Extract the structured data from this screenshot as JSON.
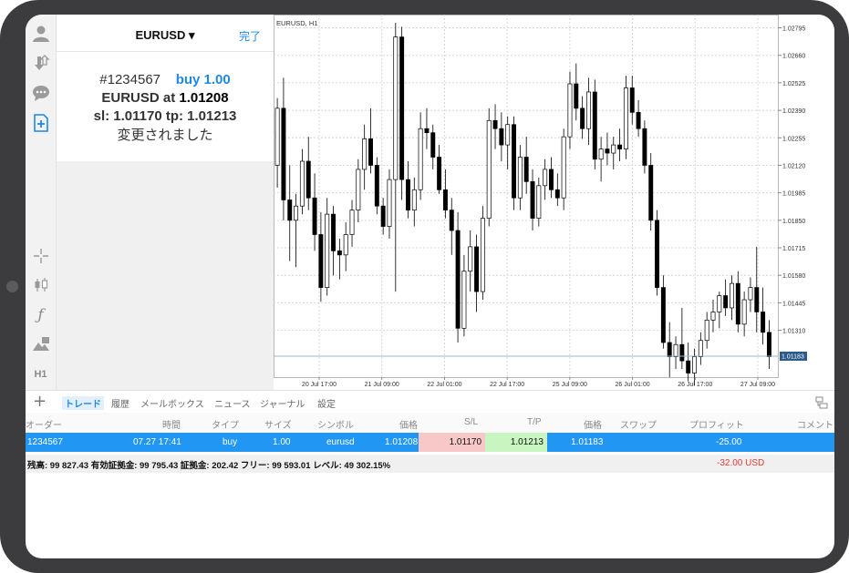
{
  "order_panel": {
    "symbol_selector": "EURUSD ▾",
    "done_label": "完了",
    "order_number": "#1234567",
    "order_action": "buy 1.00",
    "price_prefix": "EURUSD at",
    "price_value": "1.01208",
    "sl_tp_line": "sl: 1.01170 tp: 1.01213",
    "status_message": "変更されました"
  },
  "toolbar": {
    "timeframe_label": "H1"
  },
  "chart": {
    "title": "EURUSD, H1",
    "current_price": "1.01183",
    "colors": {
      "bull": "#ffffff",
      "bear": "#000000",
      "grid": "#d0d0d0",
      "price_line": "#9eb4cc",
      "price_tag": "#2a5a8a"
    }
  },
  "chart_data": {
    "type": "candlestick",
    "title": "EURUSD, H1",
    "ylim": [
      1.0108,
      1.0286
    ],
    "y_ticks": [
      "1.02795",
      "1.02660",
      "1.02525",
      "1.02390",
      "1.02255",
      "1.02120",
      "1.01985",
      "1.01850",
      "1.01715",
      "1.01580",
      "1.01445",
      "1.01310"
    ],
    "x_ticks": [
      "20 Jul 17:00",
      "21 Jul 09:00",
      "22 Jul 01:00",
      "22 Jul 17:00",
      "25 Jul 09:00",
      "26 Jul 01:00",
      "26 Jul 17:00",
      "27 Jul 09:00"
    ],
    "candles": [
      [
        1.0212,
        1.0245,
        1.0201,
        1.024
      ],
      [
        1.024,
        1.0255,
        1.0185,
        1.0195
      ],
      [
        1.0195,
        1.0212,
        1.0165,
        1.0185
      ],
      [
        1.0185,
        1.0198,
        1.0162,
        1.0192
      ],
      [
        1.0192,
        1.022,
        1.0188,
        1.0214
      ],
      [
        1.0214,
        1.0226,
        1.019,
        1.0196
      ],
      [
        1.0196,
        1.0208,
        1.017,
        1.0178
      ],
      [
        1.0178,
        1.0189,
        1.0145,
        1.0152
      ],
      [
        1.0152,
        1.0196,
        1.0148,
        1.0188
      ],
      [
        1.0188,
        1.0192,
        1.0158,
        1.017
      ],
      [
        1.017,
        1.0176,
        1.0156,
        1.0168
      ],
      [
        1.0168,
        1.0184,
        1.016,
        1.0178
      ],
      [
        1.0178,
        1.0195,
        1.0172,
        1.019
      ],
      [
        1.019,
        1.0215,
        1.0184,
        1.021
      ],
      [
        1.021,
        1.0232,
        1.02,
        1.0225
      ],
      [
        1.0225,
        1.024,
        1.0208,
        1.0212
      ],
      [
        1.0212,
        1.0216,
        1.0188,
        1.0192
      ],
      [
        1.0192,
        1.0196,
        1.0178,
        1.0182
      ],
      [
        1.0182,
        1.021,
        1.0176,
        1.0205
      ],
      [
        1.0205,
        1.0282,
        1.015,
        1.0275
      ],
      [
        1.0275,
        1.028,
        1.0195,
        1.0205
      ],
      [
        1.0205,
        1.0214,
        1.0186,
        1.019
      ],
      [
        1.019,
        1.0206,
        1.0182,
        1.02
      ],
      [
        1.02,
        1.0238,
        1.0195,
        1.023
      ],
      [
        1.023,
        1.024,
        1.022,
        1.0228
      ],
      [
        1.0228,
        1.0232,
        1.021,
        1.0216
      ],
      [
        1.0216,
        1.0222,
        1.0198,
        1.02
      ],
      [
        1.02,
        1.021,
        1.0186,
        1.019
      ],
      [
        1.019,
        1.0196,
        1.0168,
        1.018
      ],
      [
        1.018,
        1.0189,
        1.0125,
        1.0132
      ],
      [
        1.0132,
        1.0168,
        1.0128,
        1.016
      ],
      [
        1.016,
        1.018,
        1.015,
        1.0172
      ],
      [
        1.0172,
        1.0178,
        1.014,
        1.015
      ],
      [
        1.015,
        1.0192,
        1.0146,
        1.0186
      ],
      [
        1.0186,
        1.024,
        1.0182,
        1.0234
      ],
      [
        1.0234,
        1.0242,
        1.022,
        1.023
      ],
      [
        1.023,
        1.0238,
        1.0214,
        1.0222
      ],
      [
        1.0222,
        1.0236,
        1.021,
        1.0232
      ],
      [
        1.0232,
        1.0236,
        1.019,
        1.0196
      ],
      [
        1.0196,
        1.0222,
        1.019,
        1.0216
      ],
      [
        1.0216,
        1.0226,
        1.0198,
        1.0204
      ],
      [
        1.0204,
        1.021,
        1.018,
        1.0186
      ],
      [
        1.0186,
        1.0206,
        1.0182,
        1.0202
      ],
      [
        1.0202,
        1.0215,
        1.0195,
        1.021
      ],
      [
        1.021,
        1.0216,
        1.0196,
        1.02
      ],
      [
        1.02,
        1.0208,
        1.0192,
        1.0196
      ],
      [
        1.0196,
        1.023,
        1.019,
        1.0226
      ],
      [
        1.0226,
        1.0258,
        1.022,
        1.0252
      ],
      [
        1.0252,
        1.0262,
        1.0234,
        1.024
      ],
      [
        1.024,
        1.0246,
        1.0225,
        1.023
      ],
      [
        1.023,
        1.0255,
        1.0222,
        1.0248
      ],
      [
        1.0248,
        1.0254,
        1.021,
        1.0215
      ],
      [
        1.0215,
        1.0226,
        1.0204,
        1.022
      ],
      [
        1.022,
        1.0228,
        1.0212,
        1.0218
      ],
      [
        1.0218,
        1.0226,
        1.021,
        1.0222
      ],
      [
        1.0222,
        1.023,
        1.0214,
        1.022
      ],
      [
        1.022,
        1.0256,
        1.0215,
        1.025
      ],
      [
        1.025,
        1.0256,
        1.0232,
        1.0238
      ],
      [
        1.0238,
        1.0244,
        1.0226,
        1.023
      ],
      [
        1.023,
        1.0234,
        1.0208,
        1.0212
      ],
      [
        1.0212,
        1.0218,
        1.018,
        1.0185
      ],
      [
        1.0185,
        1.019,
        1.0148,
        1.0152
      ],
      [
        1.0152,
        1.0158,
        1.0122,
        1.0125
      ],
      [
        1.0125,
        1.0135,
        1.0108,
        1.0118
      ],
      [
        1.0118,
        1.0128,
        1.0112,
        1.0124
      ],
      [
        1.0124,
        1.0142,
        1.0112,
        1.0116
      ],
      [
        1.0116,
        1.0125,
        1.0106,
        1.011
      ],
      [
        1.011,
        1.0122,
        1.0104,
        1.0118
      ],
      [
        1.0118,
        1.013,
        1.0114,
        1.0126
      ],
      [
        1.0126,
        1.014,
        1.0122,
        1.0136
      ],
      [
        1.0136,
        1.0146,
        1.013,
        1.014
      ],
      [
        1.014,
        1.015,
        1.0132,
        1.0148
      ],
      [
        1.0148,
        1.0156,
        1.0138,
        1.0142
      ],
      [
        1.0142,
        1.0158,
        1.0136,
        1.0154
      ],
      [
        1.0154,
        1.016,
        1.013,
        1.0134
      ],
      [
        1.0134,
        1.015,
        1.0128,
        1.0146
      ],
      [
        1.0146,
        1.0157,
        1.014,
        1.0152
      ],
      [
        1.0152,
        1.0172,
        1.013,
        1.014
      ],
      [
        1.014,
        1.0152,
        1.0124,
        1.013
      ],
      [
        1.013,
        1.0136,
        1.0112,
        1.0118
      ]
    ]
  },
  "tabs": [
    {
      "label": "トレード",
      "active": true
    },
    {
      "label": "履歴"
    },
    {
      "label": "メールボックス"
    },
    {
      "label": "ニュース"
    },
    {
      "label": "ジャーナル"
    },
    {
      "label": "設定"
    }
  ],
  "table": {
    "headers": [
      "オーダー",
      "時間",
      "タイプ",
      "サイズ",
      "シンボル",
      "価格",
      "S/L",
      "T/P",
      "価格",
      "スワップ",
      "プロフィット",
      "コメント"
    ],
    "row": {
      "order": "1234567",
      "time": "07.27 17:41",
      "type": "buy",
      "size": "1.00",
      "symbol": "eurusd",
      "price": "1.01208",
      "sl": "1.01170",
      "tp": "1.01213",
      "current_price": "1.01183",
      "swap": "",
      "profit": "-25.00",
      "comment": ""
    }
  },
  "summary": {
    "text": "残高: 99 827.43 有効証拠金: 99 795.43 証拠金: 202.42 フリー: 99 593.01 レベル: 49 302.15%",
    "profit": "-32.00  USD"
  }
}
